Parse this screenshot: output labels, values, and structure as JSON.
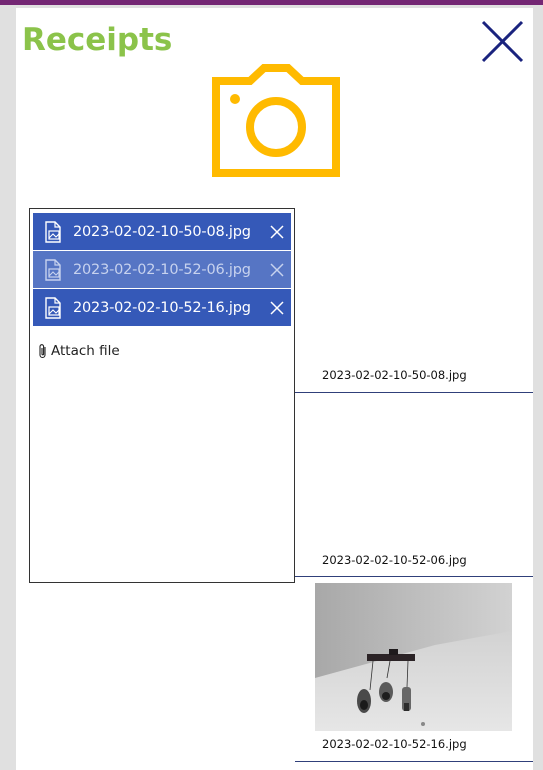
{
  "screen": {
    "title": "Receipts",
    "accent_title_color": "#8bc34a",
    "camera_color": "#ffba00",
    "close_color": "#1a237e"
  },
  "attachments": {
    "files": [
      {
        "name": "2023-02-02-10-50-08.jpg",
        "state": "normal"
      },
      {
        "name": "2023-02-02-10-52-06.jpg",
        "state": "dim"
      },
      {
        "name": "2023-02-02-10-52-16.jpg",
        "state": "normal"
      }
    ],
    "attach_label": "Attach file"
  },
  "gallery": [
    {
      "caption": "2023-02-02-10-50-08.jpg",
      "has_image": false
    },
    {
      "caption": "2023-02-02-10-52-06.jpg",
      "has_image": false
    },
    {
      "caption": "2023-02-02-10-52-16.jpg",
      "has_image": true
    }
  ]
}
